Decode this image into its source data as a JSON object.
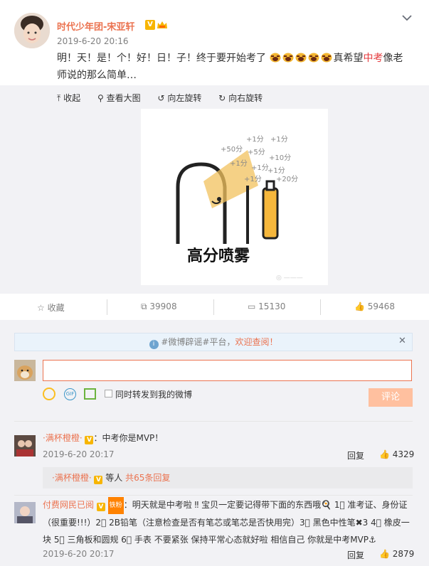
{
  "post": {
    "username": "时代少年团-宋亚轩",
    "time": "2019-6-20 20:16",
    "text_part1": "明！天！是！个！好！日！子！终于要开始考了",
    "text_part2": "真希望",
    "text_link": "中考",
    "text_part3": "像老师说的那么简单…"
  },
  "media_tools": {
    "collapse": "收起",
    "view_large": "查看大图",
    "rotate_left": "向左旋转",
    "rotate_right": "向右旋转"
  },
  "meme": {
    "caption": "高分喷雾",
    "floating_scores": [
      "+1分",
      "+50分",
      "+5分",
      "+1分",
      "+10分",
      "+1分",
      "+1分",
      "+1分",
      "+20分",
      "+1分"
    ]
  },
  "actions": {
    "favorite": "收藏",
    "repost": "39908",
    "comments": "15130",
    "likes": "59468"
  },
  "notice": {
    "prefix": "#微博辟谣#平台，",
    "link": "欢迎查阅！"
  },
  "composer": {
    "input_value": "",
    "forward_label": "同时转发到我的微博",
    "submit": "评论"
  },
  "comments": [
    {
      "name": "·满杯橙橙·",
      "text": "：中考你是MVP！",
      "time": "2019-6-20 20:17",
      "reply": "回复",
      "likes": "4329"
    },
    {
      "name": "付费网民已阅",
      "badge": "铁粉",
      "text": "：明天就是中考啦 ‼ 宝贝一定要记得带下面的东西哦🍳 1⃣ 准考证、身份证（很重要!!!）2⃣ 2B铅笔（注意检查是否有笔芯或笔芯是否快用完）3⃣ 黑色中性笔✖3 4⃣ 橡皮一块 5⃣ 三角板和圆规 6⃣ 手表 不要紧张 保持平常心态就好啦 相信自己 你就是中考MVP⚓",
      "time": "2019-6-20 20:17",
      "reply": "回复",
      "likes": "2879"
    }
  ],
  "sub_replies": {
    "name": "·满杯橙橙·",
    "text": "等人",
    "count_link": "共65条回复"
  }
}
